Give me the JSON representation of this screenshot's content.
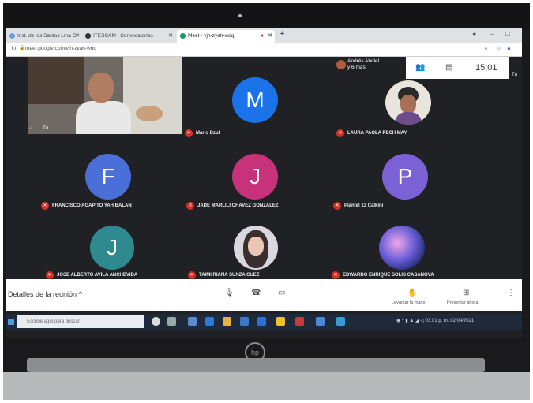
{
  "browser": {
    "tabs": [
      {
        "label": "Inst. de los Santos Lma C",
        "color": "#6aa3d8"
      },
      {
        "label": "ITESCAM | Convocatorias",
        "color": "#333333"
      },
      {
        "label": "Meet - vjh-zyah-wdq",
        "color": "#0f9d58"
      }
    ],
    "url": "meet.google.com/vjh-zyah-wdq"
  },
  "meet": {
    "self_label": "Tú",
    "others_label": "Andrés Abdiel",
    "others_more": "y 6 más",
    "clock": "15:01",
    "self_label_right": "Tú",
    "participants": [
      {
        "name": "Mario Dzul",
        "initial": "M",
        "color": "#1a73e8"
      },
      {
        "name": "LAURA PAOLA PECH MAY",
        "initial": "",
        "color": "#e9e4dc"
      },
      {
        "name": "FRANCISCO AGAPITO YAH BALAN",
        "initial": "F",
        "color": "#4a6fd8"
      },
      {
        "name": "JADE MARLILI CHAVEZ GONZALEZ",
        "initial": "J",
        "color": "#c8327a"
      },
      {
        "name": "Plantel 13 Calkini",
        "initial": "P",
        "color": "#7b61d6"
      },
      {
        "name": "JOSE ALBERTO AVILA ANCHEVIDA",
        "initial": "J",
        "color": "#2e8a8f"
      },
      {
        "name": "TAIMI RIANA SUNZA CUEZ",
        "initial": "",
        "color": "#dad7de"
      },
      {
        "name": "EDWARDO ENRIQUE SOLIS CASANOVA",
        "initial": "",
        "color": "#5a7dd8"
      }
    ],
    "details_label": "Detalles de la reunión",
    "raise_hand_label": "Levantar la mano",
    "present_label": "Presentar ahora"
  },
  "taskbar": {
    "search_placeholder": "Escribe aquí para buscar",
    "time": "03:01 p. m.",
    "date": "02/04/2021"
  },
  "laptop": {
    "brand": "hp"
  }
}
